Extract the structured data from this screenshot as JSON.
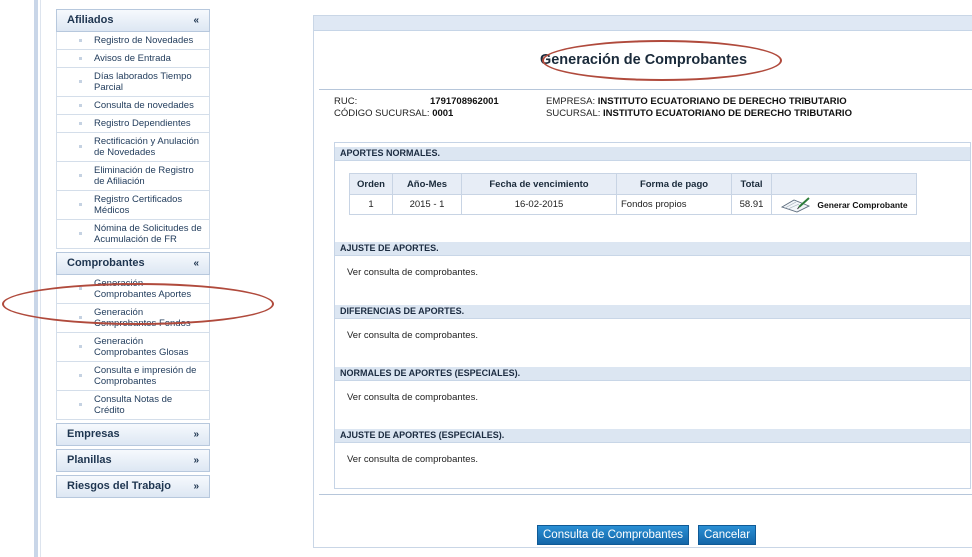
{
  "sidebar": {
    "sections": [
      {
        "title": "Afiliados",
        "chevron": "«",
        "items": [
          "Registro de Novedades",
          "Avisos de Entrada",
          "Días laborados Tiempo Parcial",
          "Consulta de novedades",
          "Registro Dependientes",
          "Rectificación y Anulación de Novedades",
          "Eliminación de Registro de Afiliación",
          "Registro Certificados Médicos",
          "Nómina de Solicitudes de Acumulación de FR"
        ]
      },
      {
        "title": "Comprobantes",
        "chevron": "«",
        "items": [
          "Generación Comprobantes Aportes",
          "Generación Comprobantes Fondos",
          "Generación Comprobantes Glosas",
          "Consulta e impresión de Comprobantes",
          "Consulta Notas de Crédito"
        ]
      },
      {
        "title": "Empresas",
        "chevron": "»",
        "items": []
      },
      {
        "title": "Planillas",
        "chevron": "»",
        "items": []
      },
      {
        "title": "Riesgos del Trabajo",
        "chevron": "»",
        "items": []
      }
    ]
  },
  "main": {
    "title": "Generación de Comprobantes",
    "ruc_label": "RUC:",
    "ruc_value": "1791708962001",
    "codigo_label": "CÓDIGO SUCURSAL:",
    "codigo_value": "0001",
    "empresa_label": "EMPRESA:",
    "empresa_value": "INSTITUTO ECUATORIANO DE DERECHO TRIBUTARIO",
    "sucursal_label": "SUCURSAL:",
    "sucursal_value": "INSTITUTO ECUATORIANO DE DERECHO TRIBUTARIO",
    "aportes_normales": {
      "title": "APORTES NORMALES.",
      "columns": [
        "Orden",
        "Año-Mes",
        "Fecha de vencimiento",
        "Forma de pago",
        "Total"
      ],
      "rows": [
        {
          "orden": "1",
          "anio_mes": "2015 - 1",
          "fecha": "16-02-2015",
          "forma": "Fondos propios",
          "total": "58.91",
          "action": "Generar Comprobante"
        }
      ]
    },
    "sections": [
      {
        "title": "AJUSTE DE APORTES.",
        "text": "Ver consulta de comprobantes."
      },
      {
        "title": "DIFERENCIAS DE APORTES.",
        "text": "Ver consulta de comprobantes."
      },
      {
        "title": "NORMALES DE APORTES (ESPECIALES).",
        "text": "Ver consulta de comprobantes."
      },
      {
        "title": "AJUSTE DE APORTES (ESPECIALES).",
        "text": "Ver consulta de comprobantes."
      }
    ],
    "buttons": {
      "consulta": "Consulta de Comprobantes",
      "cancelar": "Cancelar"
    }
  },
  "colors": {
    "accent_button": "#1a7bc4",
    "annotation_oval": "#b04a3c",
    "header_bg": "#dce6f2"
  }
}
